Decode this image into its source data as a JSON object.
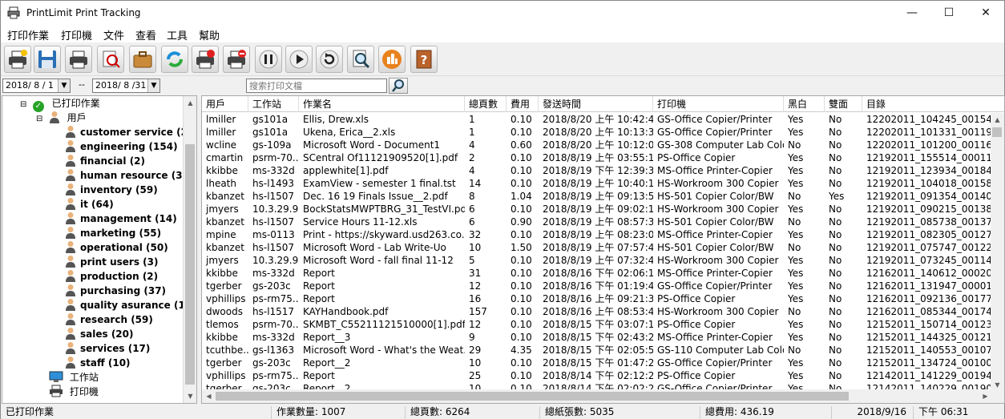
{
  "window": {
    "title": "PrintLimit Print Tracking"
  },
  "menu": [
    "打印作業",
    "打印機",
    "文件",
    "查看",
    "工具",
    "幫助"
  ],
  "toolbar": [
    "printer-star-icon",
    "save-icon",
    "print-icon",
    "search-doc-icon",
    "briefcase-icon",
    "refresh-icon",
    "printer-stop-icon",
    "printer-delete-icon",
    "pause-icon",
    "play-icon",
    "restart-icon",
    "preview-icon",
    "report-icon",
    "help-book-icon"
  ],
  "filter": {
    "date_from": "2018/ 8 / 1",
    "date_sep": "--",
    "date_to": "2018/ 8 /31",
    "search_placeholder": "搜索打印文檔"
  },
  "tree": {
    "root_label": "已打印作業",
    "users_label": "用戶",
    "groups": [
      "customer service (22)",
      "engineering (154)",
      "financial (2)",
      "human resource (30)",
      "inventory (59)",
      "it (64)",
      "management (14)",
      "marketing (55)",
      "operational (50)",
      "print users (3)",
      "production (2)",
      "purchasing (37)",
      "quality asurance (153)",
      "research (59)",
      "sales (20)",
      "services (17)",
      "staff (10)"
    ],
    "workstation_label": "工作站",
    "printer_label": "打印機"
  },
  "table": {
    "columns": [
      "用戶",
      "工作站",
      "作業名",
      "總頁數",
      "費用",
      "發送時間",
      "打印機",
      "黑白",
      "雙面",
      "目錄"
    ],
    "rows": [
      [
        "lmiller",
        "gs101a",
        "Ellis, Drew.xls",
        "1",
        "0.10",
        "2018/8/20 上午 10:42:45",
        "GS-Office Copier/Printer",
        "Yes",
        "No",
        "12202011_104245_00154.pdf"
      ],
      [
        "lmiller",
        "gs101a",
        "Ukena, Erica__2.xls",
        "1",
        "0.10",
        "2018/8/20 上午 10:13:31",
        "GS-Office Copier/Printer",
        "Yes",
        "No",
        "12202011_101331_00119.pdf"
      ],
      [
        "wcline",
        "gs-109a",
        "Microsoft Word - Document1",
        "4",
        "0.60",
        "2018/8/20 上午 10:12:00",
        "GS-308 Computer Lab Colo...",
        "No",
        "No",
        "12202011_101200_00116.pdf"
      ],
      [
        "cmartin",
        "psrm-70...",
        "SCentral Of11121909520[1].pdf",
        "2",
        "0.10",
        "2018/8/19 上午 03:55:14",
        "PS-Office Copier",
        "Yes",
        "No",
        "12192011_155514_00011.pdf"
      ],
      [
        "kkibbe",
        "ms-332d",
        "applewhite[1].pdf",
        "4",
        "0.10",
        "2018/8/19 下午 12:39:34",
        "MS-Office Printer-Copier",
        "Yes",
        "No",
        "12192011_123934_00184.pdf"
      ],
      [
        "lheath",
        "hs-l1493",
        "ExamView - semester 1 final.tst",
        "14",
        "0.10",
        "2018/8/19 上午 10:40:18",
        "HS-Workroom 300 Copier",
        "Yes",
        "No",
        "12192011_104018_00158.pdf"
      ],
      [
        "kbanzet",
        "hs-l1507",
        "Dec. 16  19 Finals Issue__2.pdf",
        "8",
        "1.04",
        "2018/8/19 上午 09:13:54",
        "HS-501 Copier Color/BW",
        "No",
        "Yes",
        "12192011_091354_00140.pdf"
      ],
      [
        "jmyers",
        "10.3.29.96",
        "BockStatsMWPTBRG_31_TestVI.pdf",
        "6",
        "0.10",
        "2018/8/19 上午 09:02:15",
        "HS-Workroom 300 Copier",
        "Yes",
        "No",
        "12192011_090215_00138.pdf"
      ],
      [
        "kbanzet",
        "hs-l1507",
        "Service Hours 11-12.xls",
        "6",
        "0.90",
        "2018/8/19 上午 08:57:38",
        "HS-501 Copier Color/BW",
        "No",
        "No",
        "12192011_085738_00137.pdf"
      ],
      [
        "mpine",
        "ms-0113",
        "Print - https://skyward.usd263.co...",
        "32",
        "0.10",
        "2018/8/19 上午 08:23:05",
        "MS-Office Printer-Copier",
        "Yes",
        "No",
        "12192011_082305_00127.pdf"
      ],
      [
        "kbanzet",
        "hs-l1507",
        "Microsoft Word - Lab Write-Uo",
        "10",
        "1.50",
        "2018/8/19 上午 07:57:47",
        "HS-501 Copier Color/BW",
        "No",
        "No",
        "12192011_075747_00122.pdf"
      ],
      [
        "jmyers",
        "10.3.29.96",
        "Microsoft Word - fall final 11-12",
        "5",
        "0.10",
        "2018/8/19 上午 07:32:45",
        "HS-Workroom 300 Copier",
        "Yes",
        "No",
        "12192011_073245_00114.pdf"
      ],
      [
        "kkibbe",
        "ms-332d",
        "Report",
        "31",
        "0.10",
        "2018/8/16 下午 02:06:12",
        "MS-Office Printer-Copier",
        "Yes",
        "No",
        "12162011_140612_00020.pdf"
      ],
      [
        "tgerber",
        "gs-203c",
        "Report",
        "12",
        "0.10",
        "2018/8/16 下午 01:19:47",
        "GS-Office Copier/Printer",
        "Yes",
        "No",
        "12162011_131947_00001.pdf"
      ],
      [
        "vphillips",
        "ps-rm75...",
        "Report",
        "16",
        "0.10",
        "2018/8/16 上午 09:21:36",
        "PS-Office Copier",
        "Yes",
        "No",
        "12162011_092136_00177.pdf"
      ],
      [
        "dwoods",
        "hs-l1517",
        "KAYHandbook.pdf",
        "157",
        "0.10",
        "2018/8/16 上午 08:53:44",
        "HS-Workroom 300 Copier",
        "No",
        "No",
        "12162011_085344_00174.pdf"
      ],
      [
        "tlemos",
        "psrm-70...",
        "SKMBT_C55211121510000[1].pdf",
        "12",
        "0.10",
        "2018/8/15 下午 03:07:14",
        "PS-Office Copier",
        "Yes",
        "No",
        "12152011_150714_00123.pdf"
      ],
      [
        "kkibbe",
        "ms-332d",
        "Report__3",
        "9",
        "0.10",
        "2018/8/15 下午 02:43:25",
        "MS-Office Printer-Copier",
        "Yes",
        "No",
        "12152011_144325_00121.pdf"
      ],
      [
        "tcuthbe...",
        "gs-l1363",
        "Microsoft Word - What's the Weat...",
        "29",
        "4.35",
        "2018/8/15 下午 02:05:53",
        "GS-110 Computer Lab Colo...",
        "No",
        "No",
        "12152011_140553_00107.pdf"
      ],
      [
        "tgerber",
        "gs-203c",
        "Report__2",
        "10",
        "0.10",
        "2018/8/15 下午 01:47:24",
        "GS-Office Copier/Printer",
        "Yes",
        "No",
        "12152011_134724_00100.pdf"
      ],
      [
        "vphillips",
        "ps-rm75...",
        "Report",
        "25",
        "0.10",
        "2018/8/14 下午 02:12:29",
        "PS-Office Copier",
        "Yes",
        "No",
        "12142011_141229_00194.pdf"
      ],
      [
        "tgerber",
        "gs-203c",
        "Report__2",
        "10",
        "0.10",
        "2018/8/14 下午 02:02:29",
        "GS-Office Copier/Printer",
        "Yes",
        "No",
        "12142011_140229_00190.pdf"
      ]
    ]
  },
  "status": {
    "section": "已打印作業",
    "job_count": "作業數量: 1007",
    "total_pages": "總頁數: 6264",
    "total_sheets": "總紙張數: 5035",
    "total_cost": "總費用: 436.19",
    "date": "2018/9/16",
    "time": "下午 06:31"
  }
}
